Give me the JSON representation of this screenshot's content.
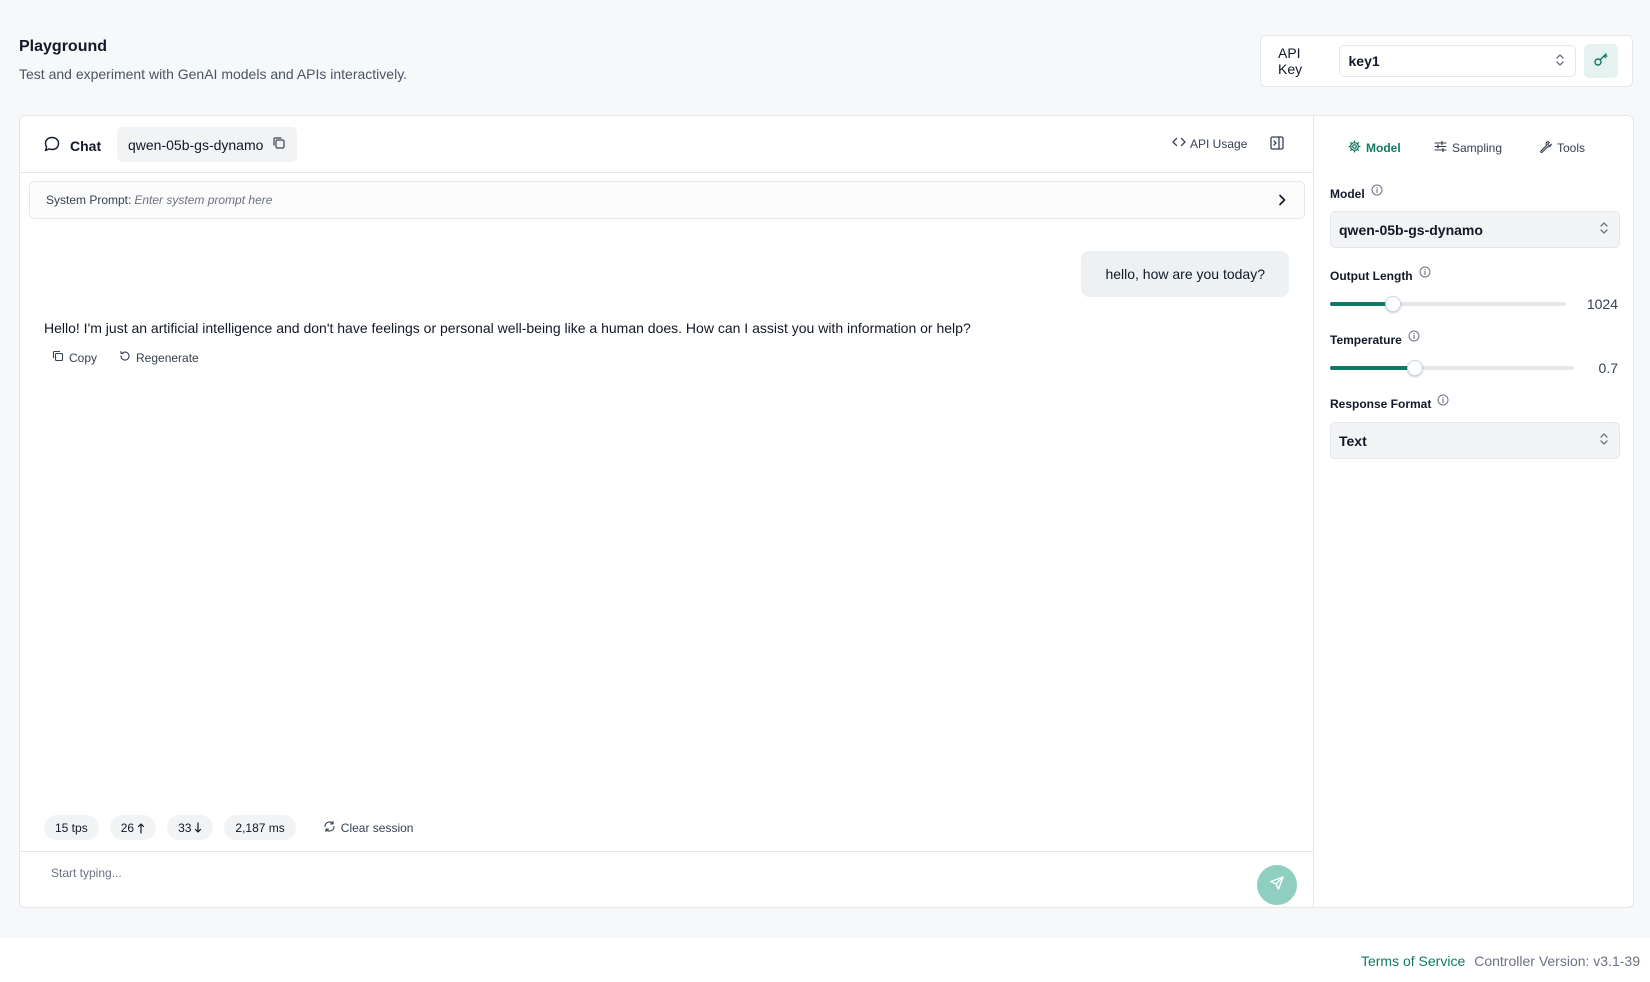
{
  "header": {
    "title": "Playground",
    "subtitle": "Test and experiment with GenAI models and APIs interactively."
  },
  "api_key": {
    "label": "API Key",
    "selected": "key1"
  },
  "chat": {
    "tab_label": "Chat",
    "model_chip": "qwen-05b-gs-dynamo",
    "api_usage_label": "API Usage",
    "system_prompt": {
      "label": "System Prompt:",
      "placeholder": "Enter system prompt here"
    },
    "messages": [
      {
        "role": "user",
        "text": "hello, how are you today?"
      },
      {
        "role": "assistant",
        "text": "Hello! I'm just an artificial intelligence and don't have feelings or personal well-being like a human does. How can I assist you with information or help?"
      }
    ],
    "actions": {
      "copy": "Copy",
      "regenerate": "Regenerate"
    },
    "stats": {
      "tps": "15 tps",
      "tokens_up": "26",
      "tokens_down": "33",
      "latency": "2,187 ms"
    },
    "clear_session": "Clear session",
    "composer_placeholder": "Start typing..."
  },
  "settings": {
    "tabs": [
      {
        "label": "Model",
        "icon": "gear-icon",
        "active": true
      },
      {
        "label": "Sampling",
        "icon": "sliders-icon",
        "active": false
      },
      {
        "label": "Tools",
        "icon": "wrench-icon",
        "active": false
      }
    ],
    "model": {
      "label": "Model",
      "selected": "qwen-05b-gs-dynamo"
    },
    "output_length": {
      "label": "Output Length",
      "value": "1024",
      "fraction": 0.265
    },
    "temperature": {
      "label": "Temperature",
      "value": "0.7",
      "fraction": 0.35
    },
    "response_format": {
      "label": "Response Format",
      "selected": "Text"
    }
  },
  "footer": {
    "terms": "Terms of Service",
    "version": "Controller Version: v3.1-39"
  },
  "colors": {
    "accent": "#0f7a63",
    "send_button": "#8fcfbf",
    "chip_bg": "#f1f3f5"
  }
}
